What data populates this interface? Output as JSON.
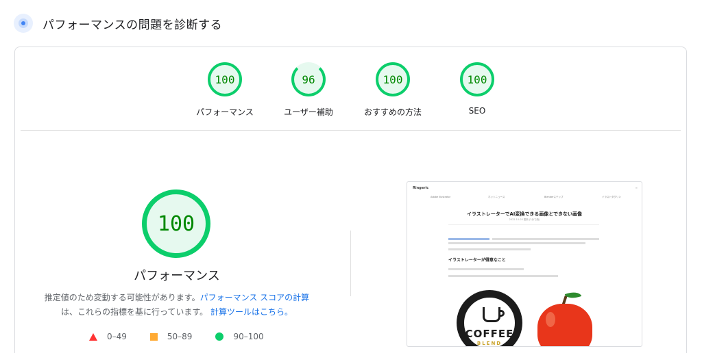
{
  "header": {
    "title": "パフォーマンスの問題を診断する",
    "icon": "diagnostics-icon"
  },
  "summary": [
    {
      "score": "100",
      "label": "パフォーマンス"
    },
    {
      "score": "96",
      "label": "ユーザー補助"
    },
    {
      "score": "100",
      "label": "おすすめの方法"
    },
    {
      "score": "100",
      "label": "SEO"
    }
  ],
  "main": {
    "score": "100",
    "label": "パフォーマンス",
    "desc_text1": "推定値のため変動する可能性があります。",
    "desc_link1": "パフォーマンス スコアの計算",
    "desc_text2": "は、これらの指標を基に行っています。",
    "desc_link2": "計算ツールはこちら。"
  },
  "legend": [
    {
      "range": "0–49",
      "color": "#ff3333"
    },
    {
      "range": "50–89",
      "color": "#ffaa33"
    },
    {
      "range": "90–100",
      "color": "#0cce6b"
    }
  ],
  "screenshot": {
    "brand": "Ringeric",
    "nav": [
      "Adobe Illustrator",
      "ホットニュース",
      "Blenderステップ",
      "イラストタグリン"
    ],
    "article_title": "イラストレーターでAI変換できる画像とできない画像",
    "date": "2022.10.03 更新 (2分で読)",
    "section_heading": "イラストレーターが得意なこと",
    "coffee_main": "COFFEE",
    "coffee_sub": "BLEND"
  },
  "colors": {
    "pass": "#0cce6b",
    "pass_text": "#008800",
    "average": "#ffaa33",
    "fail": "#ff3333",
    "link": "#1a73e8"
  }
}
